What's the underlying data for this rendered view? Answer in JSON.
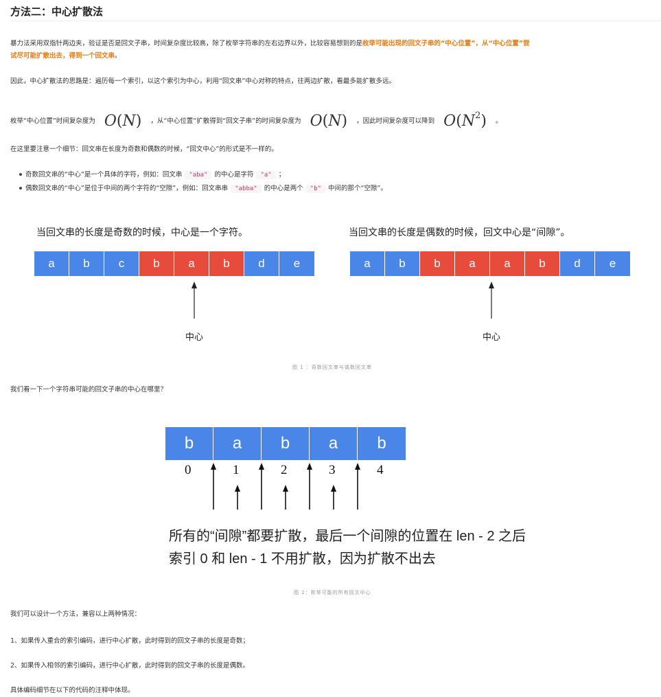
{
  "title": "方法二：中心扩散法",
  "p1": {
    "line1_normal": "暴力法采用双指针两边夹，验证是否是回文子串，时间复杂度比较高，除了枚举字符串的左右边界以外，比较容易想到的是",
    "line1_bold": "枚举可能出现的回文子串的“中心位置”，从“中心位置”尝",
    "line2_bold": "试尽可能扩散出去，得到一个回文串",
    "line2_end": "。"
  },
  "p2": "因此，中心扩散法的思路是：遍历每一个索引，以这个索引为中心，利用“回文串”中心对称的特点，往两边扩散，看最多能扩散多远。",
  "p3": {
    "a": "枚举“中心位置”时间复杂度为",
    "b": "，从“中心位置”扩散得到“回文子串”的时间复杂度为",
    "c": "，因此时间复杂度可以降到",
    "d": "。",
    "m1": "O(N)",
    "m2": "O(N)",
    "m3": "O(N^2)"
  },
  "p4": "在这里要注意一个细节：回文串在长度为奇数和偶数的时候，“回文中心”的形式是不一样的。",
  "bullets": {
    "b1_a": "奇数回文串的“中心”是一个具体的字符，例如：回文串",
    "b1_code1": "\"aba\"",
    "b1_b": "的中心是字符",
    "b1_code2": "\"a\"",
    "b1_c": "；",
    "b2_a": "偶数回文串的“中心”是位于中间的两个字符的“空隙”，例如：回文串串",
    "b2_code1": "\"abba\"",
    "b2_b": "的中心是两个",
    "b2_code2": "\"b\"",
    "b2_c": "中间的那个“空隙”。"
  },
  "figure1": {
    "left_title": "当回文串的长度是奇数的时候，中心是一个字符。",
    "right_title": "当回文串的长度是偶数的时候，回文中心是“间隙”。",
    "left_cells": [
      {
        "ch": "a",
        "color": "blue"
      },
      {
        "ch": "b",
        "color": "blue"
      },
      {
        "ch": "c",
        "color": "blue"
      },
      {
        "ch": "b",
        "color": "red"
      },
      {
        "ch": "a",
        "color": "red"
      },
      {
        "ch": "b",
        "color": "red"
      },
      {
        "ch": "d",
        "color": "blue"
      },
      {
        "ch": "e",
        "color": "blue"
      }
    ],
    "right_cells": [
      {
        "ch": "a",
        "color": "blue"
      },
      {
        "ch": "b",
        "color": "blue"
      },
      {
        "ch": "b",
        "color": "red"
      },
      {
        "ch": "a",
        "color": "red"
      },
      {
        "ch": "a",
        "color": "red"
      },
      {
        "ch": "b",
        "color": "red"
      },
      {
        "ch": "d",
        "color": "blue"
      },
      {
        "ch": "e",
        "color": "blue"
      }
    ],
    "left_center_label": "中心",
    "right_center_label": "中心",
    "caption": "图 1 ：奇数回文串与偶数回文串"
  },
  "p5": "我们看一下一个字符串可能的回文子串的中心在哪里？",
  "figure2": {
    "cells": [
      "b",
      "a",
      "b",
      "a",
      "b"
    ],
    "indices": [
      "0",
      "1",
      "2",
      "3",
      "4"
    ],
    "line1": "所有的“间隙”都要扩散，最后一个间隙的位置在 len - 2 之后",
    "line2": "索引 0 和 len - 1 不用扩散，因为扩散不出去",
    "caption": "图 2：枚举可能的所有回文中心"
  },
  "p6": "我们可以设计一个方法，兼容以上两种情况：",
  "p7": "1、如果传入重合的索引编码，进行中心扩散，此时得到的回文子串的长度是奇数；",
  "p8": "2、如果传入相邻的索引编码，进行中心扩散，此时得到的回文子串的长度是偶数。",
  "p9": "具体编码细节在以下的代码的注释中体现。",
  "colors": {
    "blue": "#4a86e8",
    "red": "#e64b3c",
    "accent": "#e57b14"
  }
}
